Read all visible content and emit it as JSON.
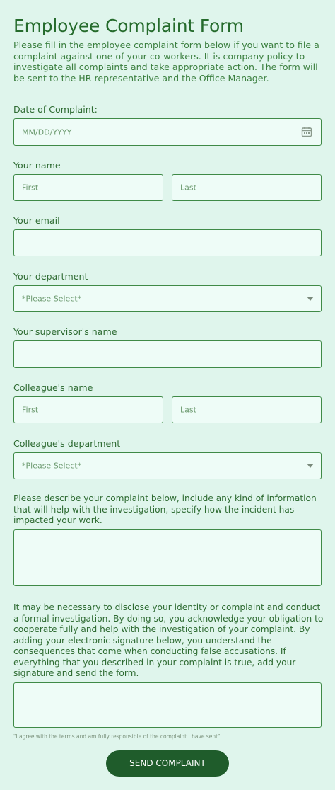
{
  "form": {
    "title": "Employee Complaint Form",
    "intro": "Please fill in the employee complaint form below if you want to file a complaint against one of your co-workers. It is company policy to investigate all complaints and take appropriate action. The form will be sent to the HR representative and the Office Manager."
  },
  "date_of_complaint": {
    "label": "Date of Complaint:",
    "placeholder": "MM/DD/YYYY",
    "icon": "calendar-icon"
  },
  "your_name": {
    "label": "Your name",
    "first_placeholder": "First",
    "last_placeholder": "Last"
  },
  "your_email": {
    "label": "Your email",
    "value": ""
  },
  "your_department": {
    "label": "Your department",
    "selected": "*Please Select*",
    "icon": "chevron-down-icon"
  },
  "supervisor_name": {
    "label": "Your supervisor's name",
    "value": ""
  },
  "colleague_name": {
    "label": "Colleague's name",
    "first_placeholder": "First",
    "last_placeholder": "Last"
  },
  "colleague_department": {
    "label": "Colleague's department",
    "selected": "*Please Select*",
    "icon": "chevron-down-icon"
  },
  "complaint_description": {
    "label": "Please describe your complaint below, include any kind of information that will help with the investigation, specify how the incident has impacted your work.",
    "value": ""
  },
  "signature": {
    "disclaimer": "It may be necessary to disclose your identity or complaint and conduct a formal investigation. By doing so, you acknowledge your obligation to cooperate fully and help with the investigation of your complaint. By adding your electronic signature below, you understand the consequences that come when conducting false accusations. If everything that you described in your complaint is true, add your signature and send the form.",
    "terms": "\"I agree with the terms and am fully responsible of the complaint I have sent\""
  },
  "submit": {
    "label": "SEND COMPLAINT"
  },
  "colors": {
    "background": "#dff5ec",
    "field_bg": "#eefcf7",
    "border": "#3f8a47",
    "text": "#2e6b32",
    "button": "#1f5c2b"
  }
}
